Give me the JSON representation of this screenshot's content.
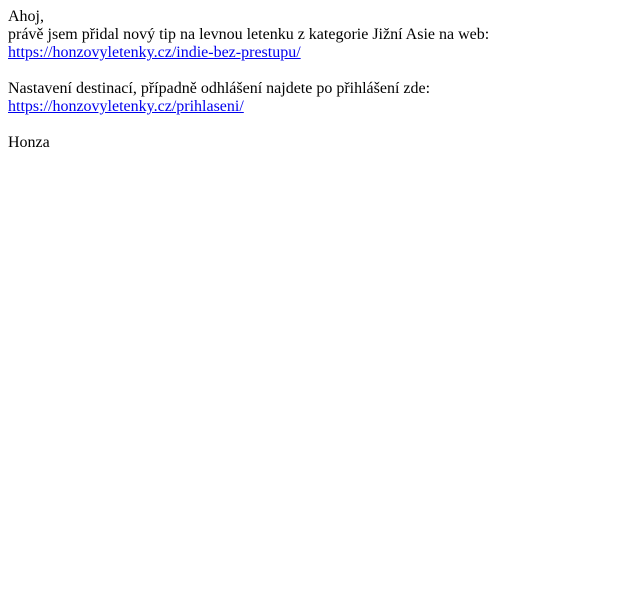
{
  "email": {
    "greeting": "Ahoj,",
    "intro": "právě jsem přidal nový tip na levnou letenku z kategorie Jižní Asie na web:",
    "tip_link": "https://honzovyletenky.cz/indie-bez-prestupu/",
    "settings_text": "Nastavení destinací, případně odhlášení najdete po přihlášení zde:",
    "login_link": "https://honzovyletenky.cz/prihlaseni/",
    "signature": "Honza"
  },
  "colors": {
    "text": "#000000",
    "link": "#0000ee",
    "background": "#ffffff"
  }
}
